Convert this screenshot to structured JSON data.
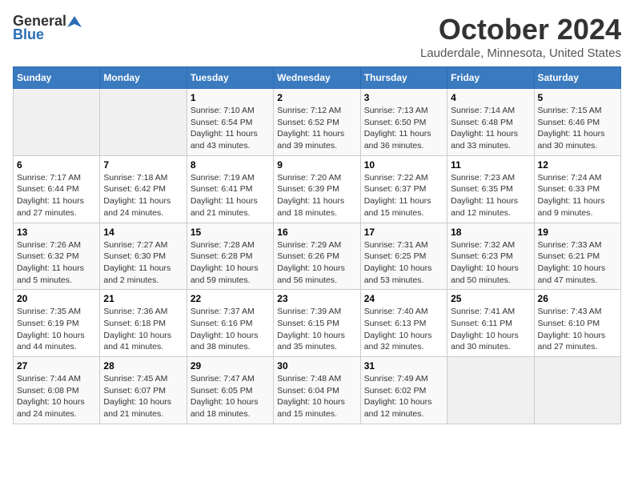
{
  "header": {
    "logo_general": "General",
    "logo_blue": "Blue",
    "month": "October 2024",
    "location": "Lauderdale, Minnesota, United States"
  },
  "days_of_week": [
    "Sunday",
    "Monday",
    "Tuesday",
    "Wednesday",
    "Thursday",
    "Friday",
    "Saturday"
  ],
  "weeks": [
    [
      {
        "day": "",
        "info": ""
      },
      {
        "day": "",
        "info": ""
      },
      {
        "day": "1",
        "info": "Sunrise: 7:10 AM\nSunset: 6:54 PM\nDaylight: 11 hours and 43 minutes."
      },
      {
        "day": "2",
        "info": "Sunrise: 7:12 AM\nSunset: 6:52 PM\nDaylight: 11 hours and 39 minutes."
      },
      {
        "day": "3",
        "info": "Sunrise: 7:13 AM\nSunset: 6:50 PM\nDaylight: 11 hours and 36 minutes."
      },
      {
        "day": "4",
        "info": "Sunrise: 7:14 AM\nSunset: 6:48 PM\nDaylight: 11 hours and 33 minutes."
      },
      {
        "day": "5",
        "info": "Sunrise: 7:15 AM\nSunset: 6:46 PM\nDaylight: 11 hours and 30 minutes."
      }
    ],
    [
      {
        "day": "6",
        "info": "Sunrise: 7:17 AM\nSunset: 6:44 PM\nDaylight: 11 hours and 27 minutes."
      },
      {
        "day": "7",
        "info": "Sunrise: 7:18 AM\nSunset: 6:42 PM\nDaylight: 11 hours and 24 minutes."
      },
      {
        "day": "8",
        "info": "Sunrise: 7:19 AM\nSunset: 6:41 PM\nDaylight: 11 hours and 21 minutes."
      },
      {
        "day": "9",
        "info": "Sunrise: 7:20 AM\nSunset: 6:39 PM\nDaylight: 11 hours and 18 minutes."
      },
      {
        "day": "10",
        "info": "Sunrise: 7:22 AM\nSunset: 6:37 PM\nDaylight: 11 hours and 15 minutes."
      },
      {
        "day": "11",
        "info": "Sunrise: 7:23 AM\nSunset: 6:35 PM\nDaylight: 11 hours and 12 minutes."
      },
      {
        "day": "12",
        "info": "Sunrise: 7:24 AM\nSunset: 6:33 PM\nDaylight: 11 hours and 9 minutes."
      }
    ],
    [
      {
        "day": "13",
        "info": "Sunrise: 7:26 AM\nSunset: 6:32 PM\nDaylight: 11 hours and 5 minutes."
      },
      {
        "day": "14",
        "info": "Sunrise: 7:27 AM\nSunset: 6:30 PM\nDaylight: 11 hours and 2 minutes."
      },
      {
        "day": "15",
        "info": "Sunrise: 7:28 AM\nSunset: 6:28 PM\nDaylight: 10 hours and 59 minutes."
      },
      {
        "day": "16",
        "info": "Sunrise: 7:29 AM\nSunset: 6:26 PM\nDaylight: 10 hours and 56 minutes."
      },
      {
        "day": "17",
        "info": "Sunrise: 7:31 AM\nSunset: 6:25 PM\nDaylight: 10 hours and 53 minutes."
      },
      {
        "day": "18",
        "info": "Sunrise: 7:32 AM\nSunset: 6:23 PM\nDaylight: 10 hours and 50 minutes."
      },
      {
        "day": "19",
        "info": "Sunrise: 7:33 AM\nSunset: 6:21 PM\nDaylight: 10 hours and 47 minutes."
      }
    ],
    [
      {
        "day": "20",
        "info": "Sunrise: 7:35 AM\nSunset: 6:19 PM\nDaylight: 10 hours and 44 minutes."
      },
      {
        "day": "21",
        "info": "Sunrise: 7:36 AM\nSunset: 6:18 PM\nDaylight: 10 hours and 41 minutes."
      },
      {
        "day": "22",
        "info": "Sunrise: 7:37 AM\nSunset: 6:16 PM\nDaylight: 10 hours and 38 minutes."
      },
      {
        "day": "23",
        "info": "Sunrise: 7:39 AM\nSunset: 6:15 PM\nDaylight: 10 hours and 35 minutes."
      },
      {
        "day": "24",
        "info": "Sunrise: 7:40 AM\nSunset: 6:13 PM\nDaylight: 10 hours and 32 minutes."
      },
      {
        "day": "25",
        "info": "Sunrise: 7:41 AM\nSunset: 6:11 PM\nDaylight: 10 hours and 30 minutes."
      },
      {
        "day": "26",
        "info": "Sunrise: 7:43 AM\nSunset: 6:10 PM\nDaylight: 10 hours and 27 minutes."
      }
    ],
    [
      {
        "day": "27",
        "info": "Sunrise: 7:44 AM\nSunset: 6:08 PM\nDaylight: 10 hours and 24 minutes."
      },
      {
        "day": "28",
        "info": "Sunrise: 7:45 AM\nSunset: 6:07 PM\nDaylight: 10 hours and 21 minutes."
      },
      {
        "day": "29",
        "info": "Sunrise: 7:47 AM\nSunset: 6:05 PM\nDaylight: 10 hours and 18 minutes."
      },
      {
        "day": "30",
        "info": "Sunrise: 7:48 AM\nSunset: 6:04 PM\nDaylight: 10 hours and 15 minutes."
      },
      {
        "day": "31",
        "info": "Sunrise: 7:49 AM\nSunset: 6:02 PM\nDaylight: 10 hours and 12 minutes."
      },
      {
        "day": "",
        "info": ""
      },
      {
        "day": "",
        "info": ""
      }
    ]
  ]
}
